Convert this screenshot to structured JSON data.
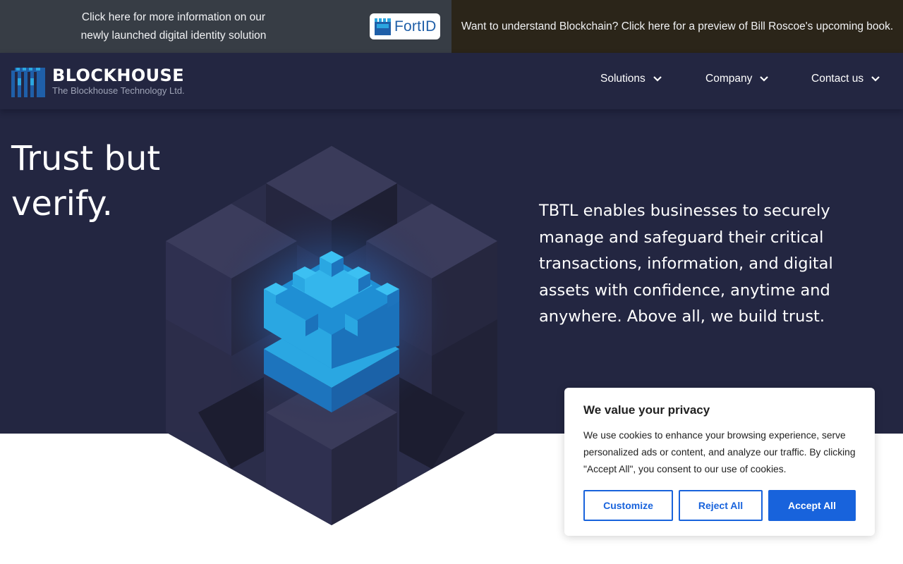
{
  "topbar": {
    "promo_text": "Click here for more information on our newly launched digital identity solution",
    "fortid_label": "FortID",
    "book_text": "Want to understand Blockchain? Click here for a preview of Bill Roscoe's upcoming book."
  },
  "logo": {
    "name": "BLOCKHOUSE",
    "subtitle": "The Blockhouse Technology Ltd."
  },
  "nav": {
    "items": [
      {
        "label": "Solutions",
        "icon": "chevron-down-icon"
      },
      {
        "label": "Company",
        "icon": "chevron-down-icon"
      },
      {
        "label": "Contact us",
        "icon": "chevron-down-icon"
      }
    ]
  },
  "hero": {
    "title": "Trust but verify.",
    "description": "TBTL enables businesses to securely manage and safeguard their critical transactions, information, and digital assets with confidence, anytime and anywhere. Above all, we build trust."
  },
  "cookie": {
    "title": "We value your privacy",
    "body": "We use cookies to enhance your browsing experience, serve personalized ads or content, and analyze our traffic. By clicking \"Accept All\", you consent to our use of cookies.",
    "customize_label": "Customize",
    "reject_label": "Reject All",
    "accept_label": "Accept All"
  },
  "colors": {
    "hero_background": "#232641",
    "accent_blue": "#1863dc",
    "topbar_left": "#373d45",
    "topbar_right": "#2b2519",
    "castle_blue": "#2ba6e0"
  }
}
